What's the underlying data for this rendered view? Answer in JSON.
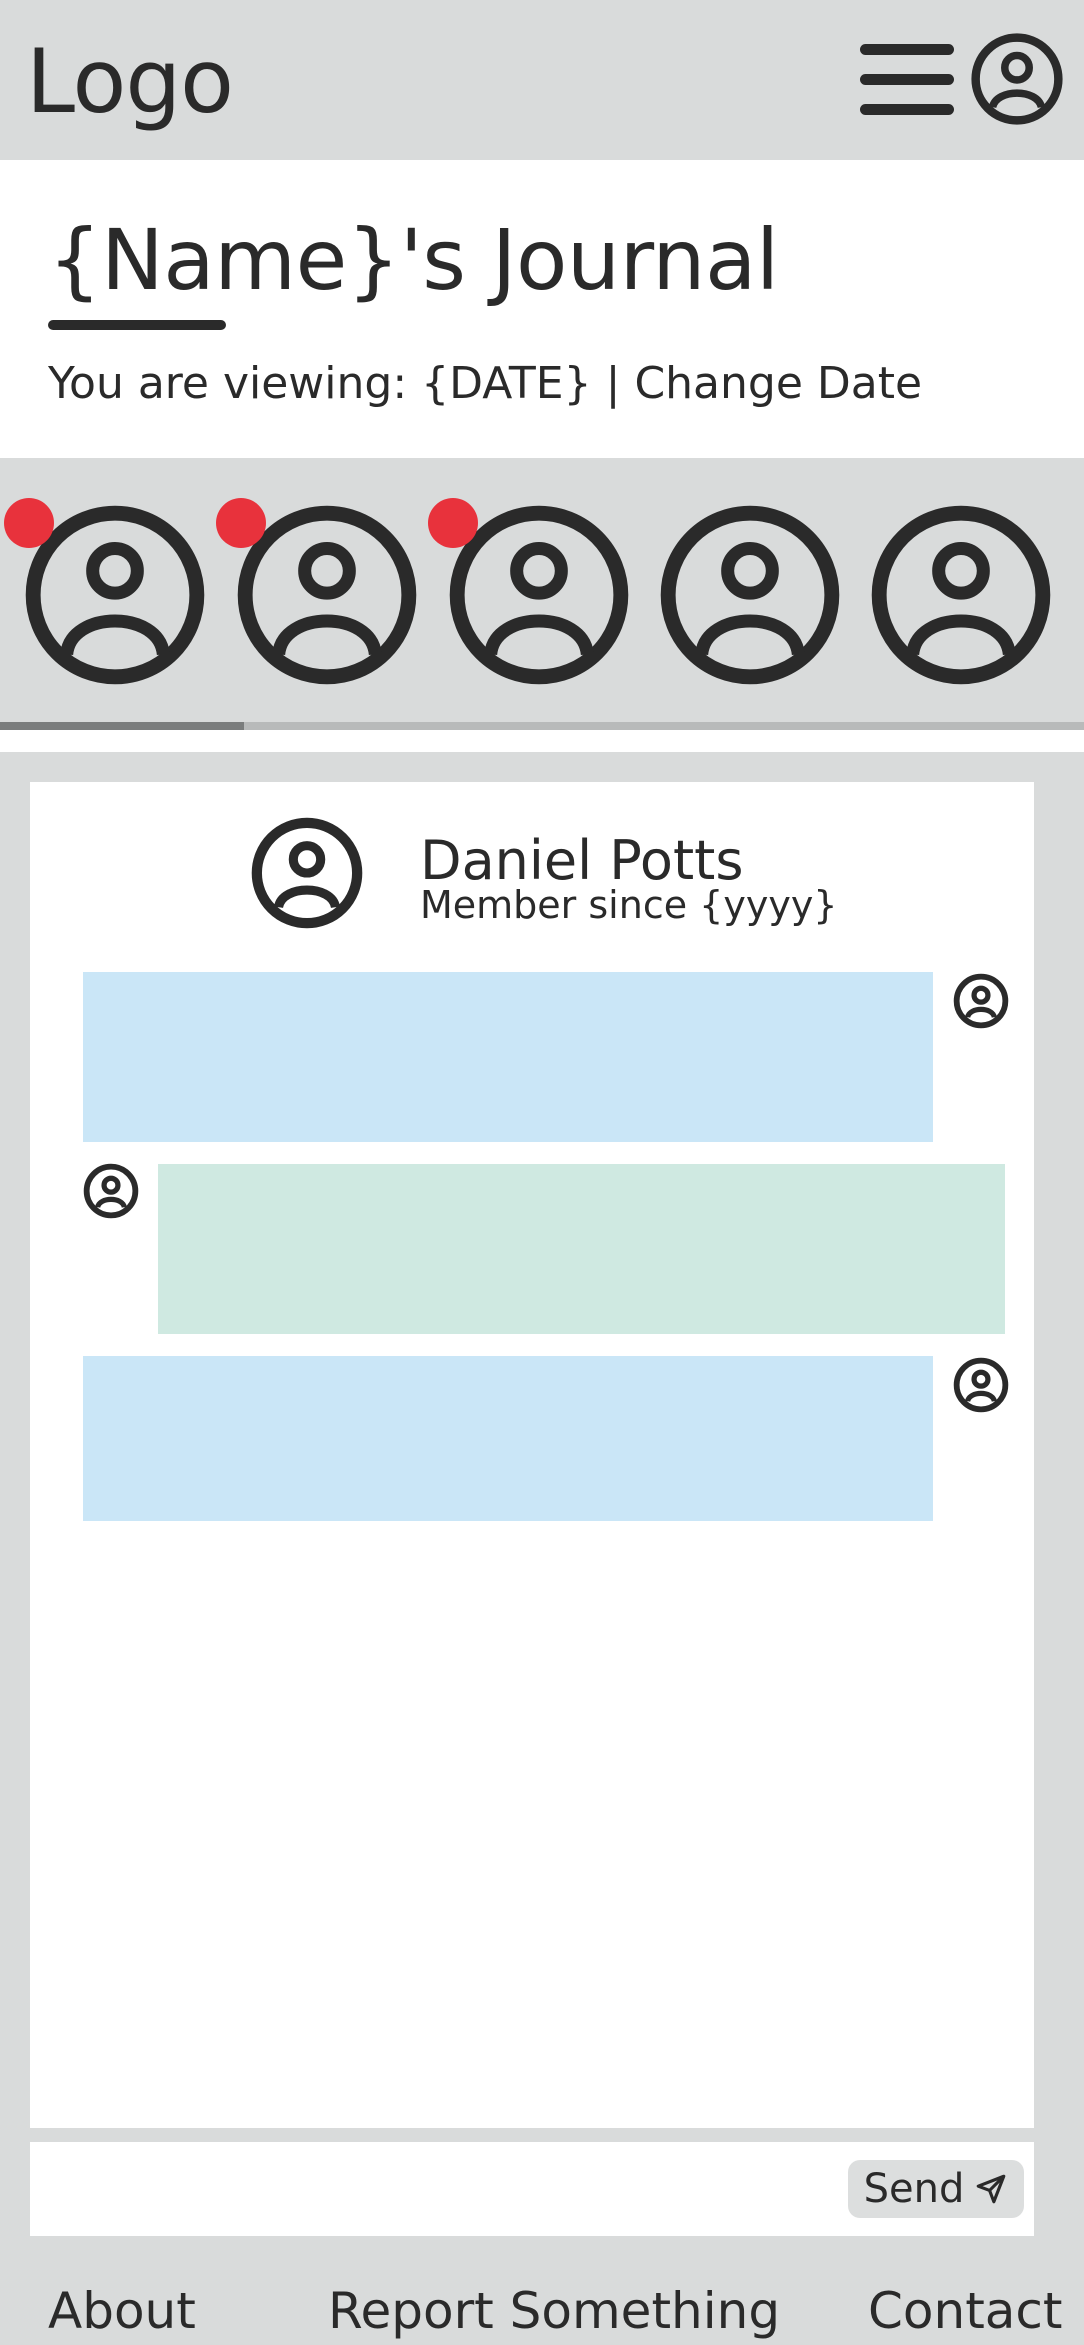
{
  "header": {
    "logo": "Logo",
    "menu_icon": "hamburger-menu-icon",
    "profile_icon": "user-circle-icon"
  },
  "journal": {
    "title": "{Name}'s Journal",
    "viewing_label": "You are viewing: {DATE}",
    "separator": "|",
    "change_date": "Change Date"
  },
  "stories": [
    {
      "icon": "user-circle-icon",
      "unread": true
    },
    {
      "icon": "user-circle-icon",
      "unread": true
    },
    {
      "icon": "user-circle-icon",
      "unread": true
    },
    {
      "icon": "user-circle-icon",
      "unread": false
    },
    {
      "icon": "user-circle-icon",
      "unread": false
    }
  ],
  "colors": {
    "background": "#d9dbdb",
    "unread": "#e8323c",
    "sent_bubble": "#cae6f7",
    "received_bubble": "#cfe9e1",
    "icon": "#2a2a2a"
  },
  "chat": {
    "name": "Daniel Potts",
    "subtitle": "Member since {yyyy}",
    "messages": [
      {
        "direction": "sent",
        "text": ""
      },
      {
        "direction": "received",
        "text": ""
      },
      {
        "direction": "sent",
        "text": ""
      }
    ]
  },
  "composer": {
    "value": "",
    "send_label": "Send",
    "send_icon": "paper-plane-icon"
  },
  "footer": {
    "about": "About",
    "report": "Report Something",
    "contact": "Contact"
  }
}
